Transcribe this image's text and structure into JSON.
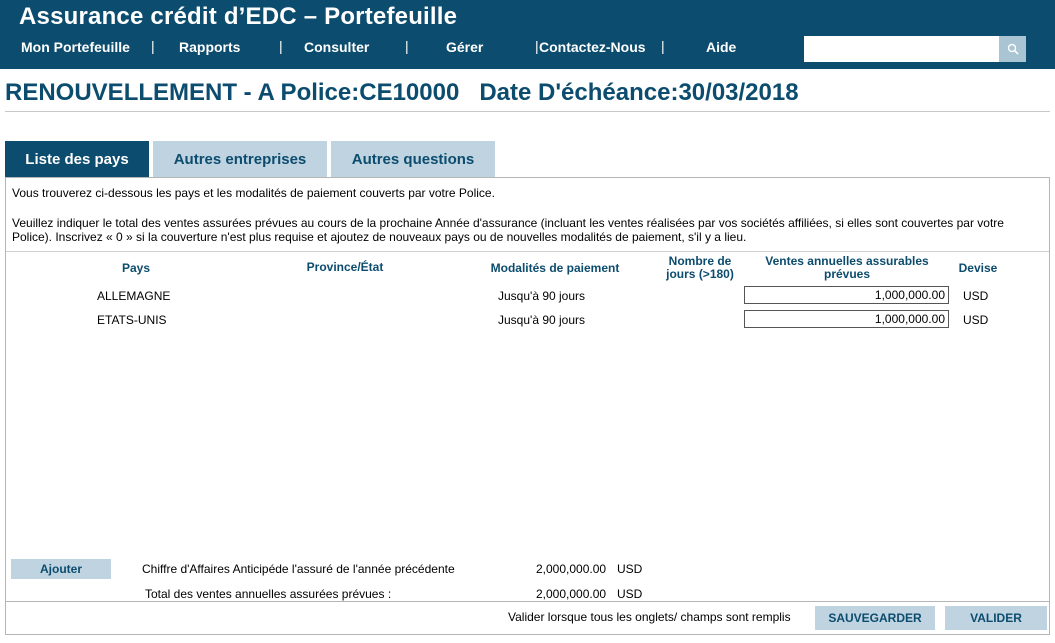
{
  "header": {
    "title": "Assurance crédit d’EDC – Portefeuille",
    "nav": [
      "Mon Portefeuille",
      "Rapports",
      "Consulter",
      "Gérer",
      "Contactez-Nous",
      "Aide"
    ],
    "separator": "|",
    "search_value": "",
    "search_icon": "search-icon"
  },
  "page": {
    "title": "RENOUVELLEMENT - A Police:CE10000   Date D'échéance:30/03/2018"
  },
  "tabs": [
    {
      "label": "Liste des pays",
      "active": true
    },
    {
      "label": "Autres entreprises",
      "active": false
    },
    {
      "label": "Autres questions",
      "active": false
    }
  ],
  "intro": {
    "line1": "Vous trouverez ci-dessous les pays et les modalités de paiement couverts par votre Police.",
    "line2": "Veuillez indiquer le total des ventes assurées prévues au cours de la prochaine Année d'assurance (incluant les ventes réalisées par vos sociétés affiliées, si elles sont couvertes par votre Police). Inscrivez « 0 » si la couverture n'est plus requise et ajoutez de nouveaux pays ou de nouvelles modalités de paiement, s'il y a lieu."
  },
  "table": {
    "headers": {
      "pays": "Pays",
      "province": "Province/État",
      "modalites": "Modalités de paiement",
      "jours": "Nombre de jours (>180)",
      "ventes": "Ventes annuelles assurables prévues",
      "devise": "Devise"
    },
    "rows": [
      {
        "pays": "ALLEMAGNE",
        "province": "",
        "modalites": "Jusqu'à 90 jours",
        "jours": "",
        "ventes": "1,000,000.00",
        "devise": "USD"
      },
      {
        "pays": "ETATS-UNIS",
        "province": "",
        "modalites": "Jusqu'à 90 jours",
        "jours": "",
        "ventes": "1,000,000.00",
        "devise": "USD"
      }
    ]
  },
  "footer": {
    "add_label": "Ajouter",
    "previous_label": "Chiffre d'Affaires Anticipéde l'assuré de l'année précédente",
    "previous_value": "2,000,000.00",
    "previous_currency": "USD",
    "total_label": "Total des ventes annuelles assurées prévues :",
    "total_value": "2,000,000.00",
    "total_currency": "USD",
    "validate_hint": "Valider lorsque tous les onglets/ champs sont remplis",
    "save_label": "SAUVEGARDER",
    "validate_label": "VALIDER"
  },
  "colors": {
    "brand": "#0c4c6e",
    "tab_inactive": "#bfd4e0"
  }
}
